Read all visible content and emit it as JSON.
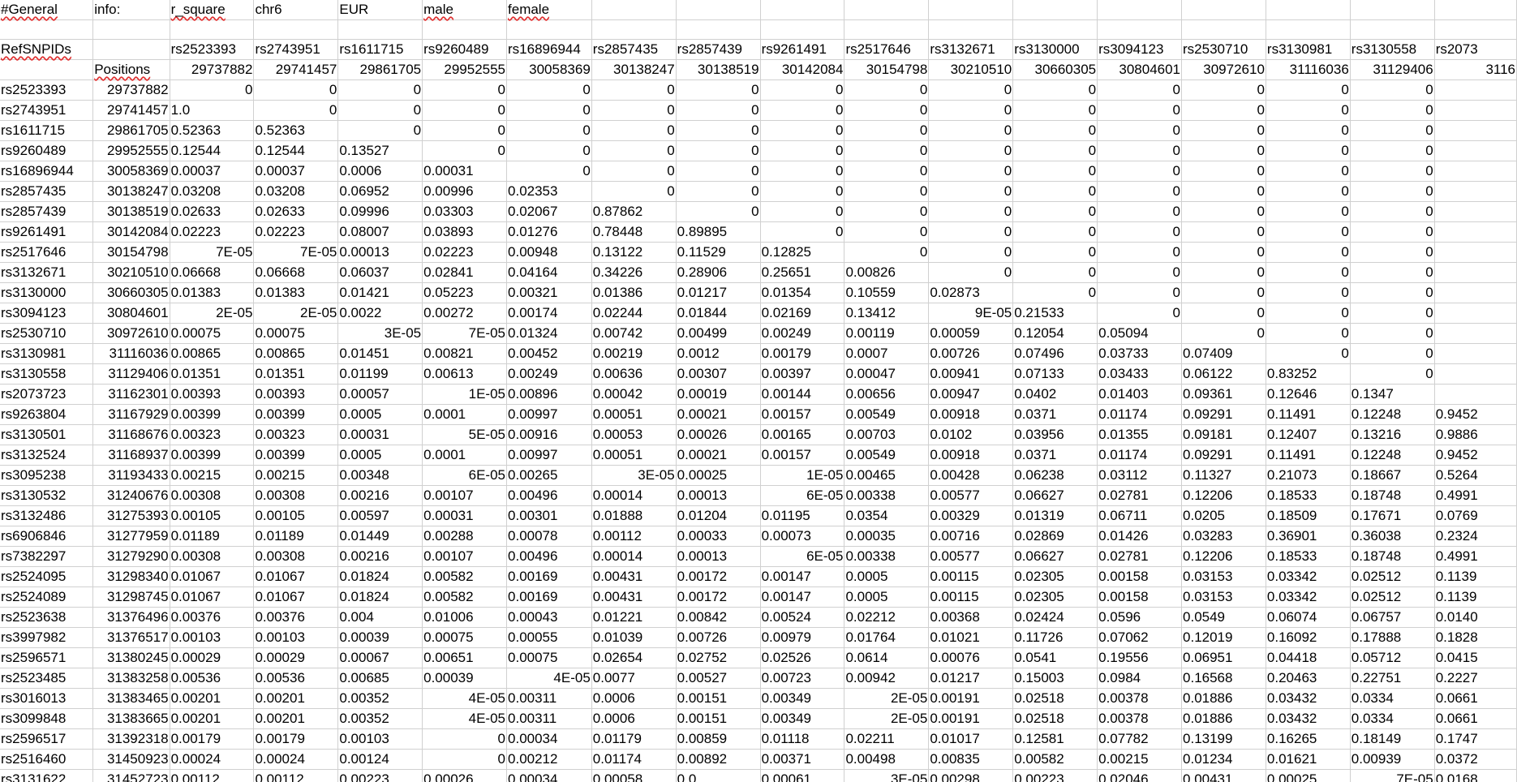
{
  "header_rows": [
    [
      "#General",
      "info:",
      "r_square",
      "chr6",
      "EUR",
      "male",
      "female"
    ],
    [],
    [
      "RefSNPIDs",
      "",
      "rs2523393",
      "rs2743951",
      "rs1611715",
      "rs9260489",
      "rs16896944",
      "rs2857435",
      "rs2857439",
      "rs9261491",
      "rs2517646",
      "rs3132671",
      "rs3130000",
      "rs3094123",
      "rs2530710",
      "rs3130981",
      "rs3130558",
      "rs2073"
    ],
    [
      "",
      "Positions",
      "29737882",
      "29741457",
      "29861705",
      "29952555",
      "30058369",
      "30138247",
      "30138519",
      "30142084",
      "30154798",
      "30210510",
      "30660305",
      "30804601",
      "30972610",
      "31116036",
      "31129406",
      "3116"
    ]
  ],
  "data_rows": [
    [
      "rs2523393",
      "29737882",
      "0",
      "0",
      "0",
      "0",
      "0",
      "0",
      "0",
      "0",
      "0",
      "0",
      "0",
      "0",
      "0",
      "0",
      "0"
    ],
    [
      "rs2743951",
      "29741457",
      "1.0",
      "0",
      "0",
      "0",
      "0",
      "0",
      "0",
      "0",
      "0",
      "0",
      "0",
      "0",
      "0",
      "0",
      "0"
    ],
    [
      "rs1611715",
      "29861705",
      "0.52363",
      "0.52363",
      "0",
      "0",
      "0",
      "0",
      "0",
      "0",
      "0",
      "0",
      "0",
      "0",
      "0",
      "0",
      "0"
    ],
    [
      "rs9260489",
      "29952555",
      "0.12544",
      "0.12544",
      "0.13527",
      "0",
      "0",
      "0",
      "0",
      "0",
      "0",
      "0",
      "0",
      "0",
      "0",
      "0",
      "0"
    ],
    [
      "rs16896944",
      "30058369",
      "0.00037",
      "0.00037",
      "0.0006",
      "0.00031",
      "0",
      "0",
      "0",
      "0",
      "0",
      "0",
      "0",
      "0",
      "0",
      "0",
      "0"
    ],
    [
      "rs2857435",
      "30138247",
      "0.03208",
      "0.03208",
      "0.06952",
      "0.00996",
      "0.02353",
      "0",
      "0",
      "0",
      "0",
      "0",
      "0",
      "0",
      "0",
      "0",
      "0"
    ],
    [
      "rs2857439",
      "30138519",
      "0.02633",
      "0.02633",
      "0.09996",
      "0.03303",
      "0.02067",
      "0.87862",
      "0",
      "0",
      "0",
      "0",
      "0",
      "0",
      "0",
      "0",
      "0"
    ],
    [
      "rs9261491",
      "30142084",
      "0.02223",
      "0.02223",
      "0.08007",
      "0.03893",
      "0.01276",
      "0.78448",
      "0.89895",
      "0",
      "0",
      "0",
      "0",
      "0",
      "0",
      "0",
      "0"
    ],
    [
      "rs2517646",
      "30154798",
      "7E-05",
      "7E-05",
      "0.00013",
      "0.02223",
      "0.00948",
      "0.13122",
      "0.11529",
      "0.12825",
      "0",
      "0",
      "0",
      "0",
      "0",
      "0",
      "0"
    ],
    [
      "rs3132671",
      "30210510",
      "0.06668",
      "0.06668",
      "0.06037",
      "0.02841",
      "0.04164",
      "0.34226",
      "0.28906",
      "0.25651",
      "0.00826",
      "0",
      "0",
      "0",
      "0",
      "0",
      "0"
    ],
    [
      "rs3130000",
      "30660305",
      "0.01383",
      "0.01383",
      "0.01421",
      "0.05223",
      "0.00321",
      "0.01386",
      "0.01217",
      "0.01354",
      "0.10559",
      "0.02873",
      "0",
      "0",
      "0",
      "0",
      "0"
    ],
    [
      "rs3094123",
      "30804601",
      "2E-05",
      "2E-05",
      "0.0022",
      "0.00272",
      "0.00174",
      "0.02244",
      "0.01844",
      "0.02169",
      "0.13412",
      "9E-05",
      "0.21533",
      "0",
      "0",
      "0",
      "0"
    ],
    [
      "rs2530710",
      "30972610",
      "0.00075",
      "0.00075",
      "3E-05",
      "7E-05",
      "0.01324",
      "0.00742",
      "0.00499",
      "0.00249",
      "0.00119",
      "0.00059",
      "0.12054",
      "0.05094",
      "0",
      "0",
      "0"
    ],
    [
      "rs3130981",
      "31116036",
      "0.00865",
      "0.00865",
      "0.01451",
      "0.00821",
      "0.00452",
      "0.00219",
      "0.0012",
      "0.00179",
      "0.0007",
      "0.00726",
      "0.07496",
      "0.03733",
      "0.07409",
      "0",
      "0"
    ],
    [
      "rs3130558",
      "31129406",
      "0.01351",
      "0.01351",
      "0.01199",
      "0.00613",
      "0.00249",
      "0.00636",
      "0.00307",
      "0.00397",
      "0.00047",
      "0.00941",
      "0.07133",
      "0.03433",
      "0.06122",
      "0.83252",
      "0"
    ],
    [
      "rs2073723",
      "31162301",
      "0.00393",
      "0.00393",
      "0.00057",
      "1E-05",
      "0.00896",
      "0.00042",
      "0.00019",
      "0.00144",
      "0.00656",
      "0.00947",
      "0.0402",
      "0.01403",
      "0.09361",
      "0.12646",
      "0.1347",
      ""
    ],
    [
      "rs9263804",
      "31167929",
      "0.00399",
      "0.00399",
      "0.0005",
      "0.0001",
      "0.00997",
      "0.00051",
      "0.00021",
      "0.00157",
      "0.00549",
      "0.00918",
      "0.0371",
      "0.01174",
      "0.09291",
      "0.11491",
      "0.12248",
      "0.9452"
    ],
    [
      "rs3130501",
      "31168676",
      "0.00323",
      "0.00323",
      "0.00031",
      "5E-05",
      "0.00916",
      "0.00053",
      "0.00026",
      "0.00165",
      "0.00703",
      "0.0102",
      "0.03956",
      "0.01355",
      "0.09181",
      "0.12407",
      "0.13216",
      "0.9886"
    ],
    [
      "rs3132524",
      "31168937",
      "0.00399",
      "0.00399",
      "0.0005",
      "0.0001",
      "0.00997",
      "0.00051",
      "0.00021",
      "0.00157",
      "0.00549",
      "0.00918",
      "0.0371",
      "0.01174",
      "0.09291",
      "0.11491",
      "0.12248",
      "0.9452"
    ],
    [
      "rs3095238",
      "31193433",
      "0.00215",
      "0.00215",
      "0.00348",
      "6E-05",
      "0.00265",
      "3E-05",
      "0.00025",
      "1E-05",
      "0.00465",
      "0.00428",
      "0.06238",
      "0.03112",
      "0.11327",
      "0.21073",
      "0.18667",
      "0.5264"
    ],
    [
      "rs3130532",
      "31240676",
      "0.00308",
      "0.00308",
      "0.00216",
      "0.00107",
      "0.00496",
      "0.00014",
      "0.00013",
      "6E-05",
      "0.00338",
      "0.00577",
      "0.06627",
      "0.02781",
      "0.12206",
      "0.18533",
      "0.18748",
      "0.4991"
    ],
    [
      "rs3132486",
      "31275393",
      "0.00105",
      "0.00105",
      "0.00597",
      "0.00031",
      "0.00301",
      "0.01888",
      "0.01204",
      "0.01195",
      "0.0354",
      "0.00329",
      "0.01319",
      "0.06711",
      "0.0205",
      "0.18509",
      "0.17671",
      "0.0769"
    ],
    [
      "rs6906846",
      "31277959",
      "0.01189",
      "0.01189",
      "0.01449",
      "0.00288",
      "0.00078",
      "0.00112",
      "0.00033",
      "0.00073",
      "0.00035",
      "0.00716",
      "0.02869",
      "0.01426",
      "0.03283",
      "0.36901",
      "0.36038",
      "0.2324"
    ],
    [
      "rs7382297",
      "31279290",
      "0.00308",
      "0.00308",
      "0.00216",
      "0.00107",
      "0.00496",
      "0.00014",
      "0.00013",
      "6E-05",
      "0.00338",
      "0.00577",
      "0.06627",
      "0.02781",
      "0.12206",
      "0.18533",
      "0.18748",
      "0.4991"
    ],
    [
      "rs2524095",
      "31298340",
      "0.01067",
      "0.01067",
      "0.01824",
      "0.00582",
      "0.00169",
      "0.00431",
      "0.00172",
      "0.00147",
      "0.0005",
      "0.00115",
      "0.02305",
      "0.00158",
      "0.03153",
      "0.03342",
      "0.02512",
      "0.1139"
    ],
    [
      "rs2524089",
      "31298745",
      "0.01067",
      "0.01067",
      "0.01824",
      "0.00582",
      "0.00169",
      "0.00431",
      "0.00172",
      "0.00147",
      "0.0005",
      "0.00115",
      "0.02305",
      "0.00158",
      "0.03153",
      "0.03342",
      "0.02512",
      "0.1139"
    ],
    [
      "rs2523638",
      "31376496",
      "0.00376",
      "0.00376",
      "0.004",
      "0.01006",
      "0.00043",
      "0.01221",
      "0.00842",
      "0.00524",
      "0.02212",
      "0.00368",
      "0.02424",
      "0.0596",
      "0.0549",
      "0.06074",
      "0.06757",
      "0.0140"
    ],
    [
      "rs3997982",
      "31376517",
      "0.00103",
      "0.00103",
      "0.00039",
      "0.00075",
      "0.00055",
      "0.01039",
      "0.00726",
      "0.00979",
      "0.01764",
      "0.01021",
      "0.11726",
      "0.07062",
      "0.12019",
      "0.16092",
      "0.17888",
      "0.1828"
    ],
    [
      "rs2596571",
      "31380245",
      "0.00029",
      "0.00029",
      "0.00067",
      "0.00651",
      "0.00075",
      "0.02654",
      "0.02752",
      "0.02526",
      "0.0614",
      "0.00076",
      "0.0541",
      "0.19556",
      "0.06951",
      "0.04418",
      "0.05712",
      "0.0415"
    ],
    [
      "rs2523485",
      "31383258",
      "0.00536",
      "0.00536",
      "0.00685",
      "0.00039",
      "4E-05",
      "0.0077",
      "0.00527",
      "0.00723",
      "0.00942",
      "0.01217",
      "0.15003",
      "0.0984",
      "0.16568",
      "0.20463",
      "0.22751",
      "0.2227"
    ],
    [
      "rs3016013",
      "31383465",
      "0.00201",
      "0.00201",
      "0.00352",
      "4E-05",
      "0.00311",
      "0.0006",
      "0.00151",
      "0.00349",
      "2E-05",
      "0.00191",
      "0.02518",
      "0.00378",
      "0.01886",
      "0.03432",
      "0.0334",
      "0.0661"
    ],
    [
      "rs3099848",
      "31383665",
      "0.00201",
      "0.00201",
      "0.00352",
      "4E-05",
      "0.00311",
      "0.0006",
      "0.00151",
      "0.00349",
      "2E-05",
      "0.00191",
      "0.02518",
      "0.00378",
      "0.01886",
      "0.03432",
      "0.0334",
      "0.0661"
    ],
    [
      "rs2596517",
      "31392318",
      "0.00179",
      "0.00179",
      "0.00103",
      "0",
      "0.00034",
      "0.01179",
      "0.00859",
      "0.01118",
      "0.02211",
      "0.01017",
      "0.12581",
      "0.07782",
      "0.13199",
      "0.16265",
      "0.18149",
      "0.1747"
    ],
    [
      "rs2516460",
      "31450923",
      "0.00024",
      "0.00024",
      "0.00124",
      "0",
      "0.00212",
      "0.01174",
      "0.00892",
      "0.00371",
      "0.00498",
      "0.00835",
      "0.00582",
      "0.00215",
      "0.01234",
      "0.01621",
      "0.00939",
      "0.0372"
    ],
    [
      "rs3131622",
      "31452723",
      "0.00112",
      "0.00112",
      "0.00223",
      "0.00026",
      "0.00034",
      "0.00058",
      "0.0",
      "0.00061",
      "3E-05",
      "0.00298",
      "0.00223",
      "0.02046",
      "0.00431",
      "0.00025",
      "7E-05",
      "0.0168"
    ]
  ]
}
